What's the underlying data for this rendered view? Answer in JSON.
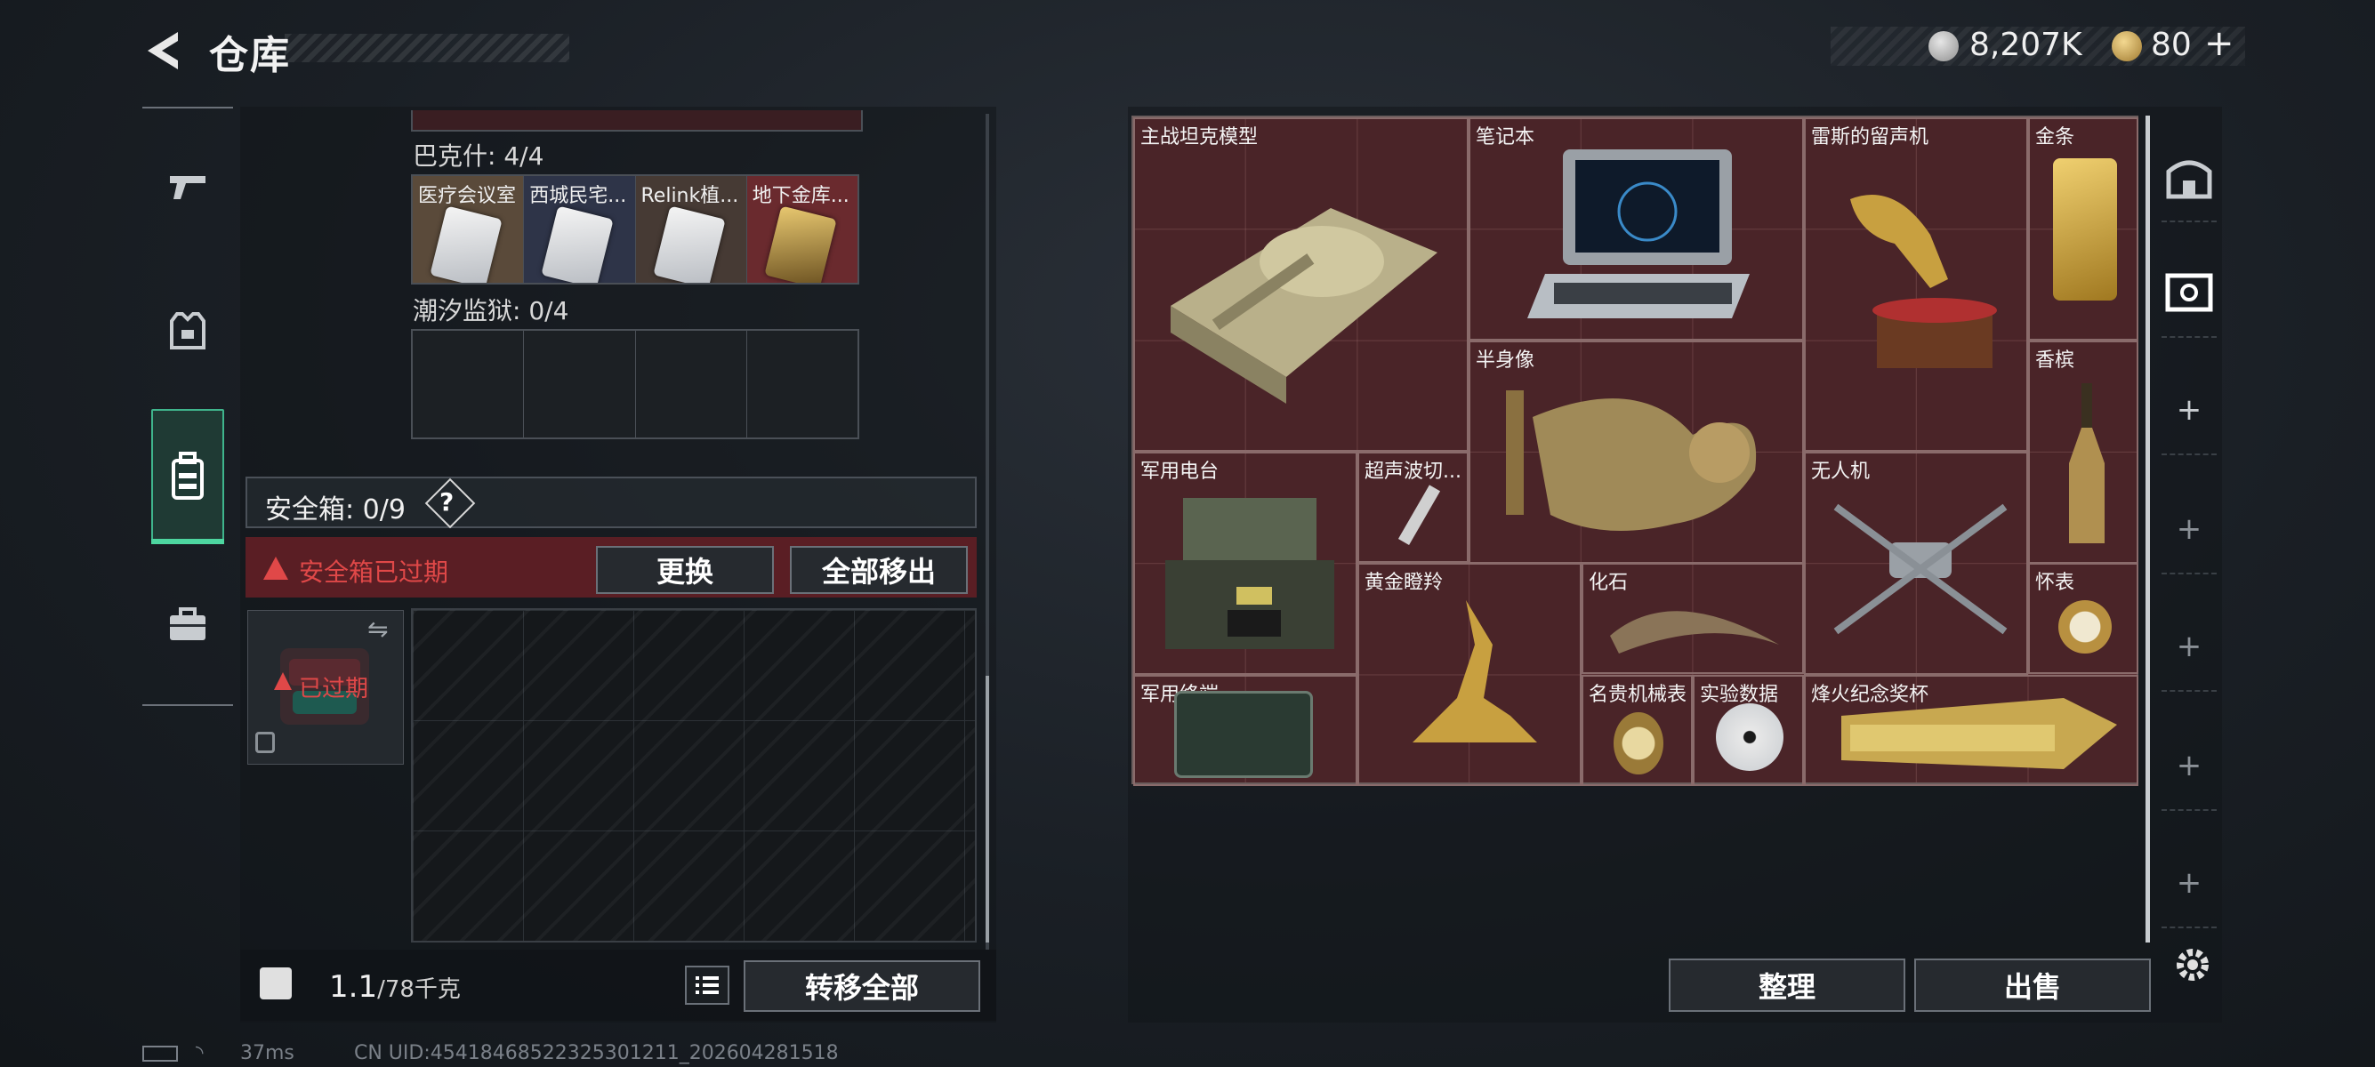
{
  "header": {
    "title": "仓库",
    "currency1": "8,207K",
    "currency2": "80",
    "plus": "+"
  },
  "left": {
    "section1_label": "巴克什: 4/4",
    "section1_slots": [
      "医疗会议室",
      "西城民宅...",
      "Relink植...",
      "地下金库..."
    ],
    "section2_label": "潮汐监狱: 0/4",
    "safe_label": "安全箱: 0/9",
    "safe_help": "?",
    "alert_text": "安全箱已过期",
    "replace_btn": "更换",
    "remove_all_btn": "全部移出",
    "expired_tag": "已过期",
    "weight_main": "1.1",
    "weight_sub": "/78千克",
    "transfer_btn": "转移全部"
  },
  "right": {
    "items": [
      "主战坦克模型",
      "笔记本",
      "雷斯的留声机",
      "金条",
      "半身像",
      "香槟",
      "军用电台",
      "超声波切...",
      "无人机",
      "黄金瞪羚",
      "化石",
      "怀表",
      "军用终端",
      "名贵机械表",
      "实验数据",
      "烽火纪念奖杯"
    ],
    "sort_btn": "整理",
    "sell_btn": "出售"
  },
  "footer": {
    "ping": "37ms",
    "uid": "CN UID:45418468522325301211_202604281518"
  }
}
